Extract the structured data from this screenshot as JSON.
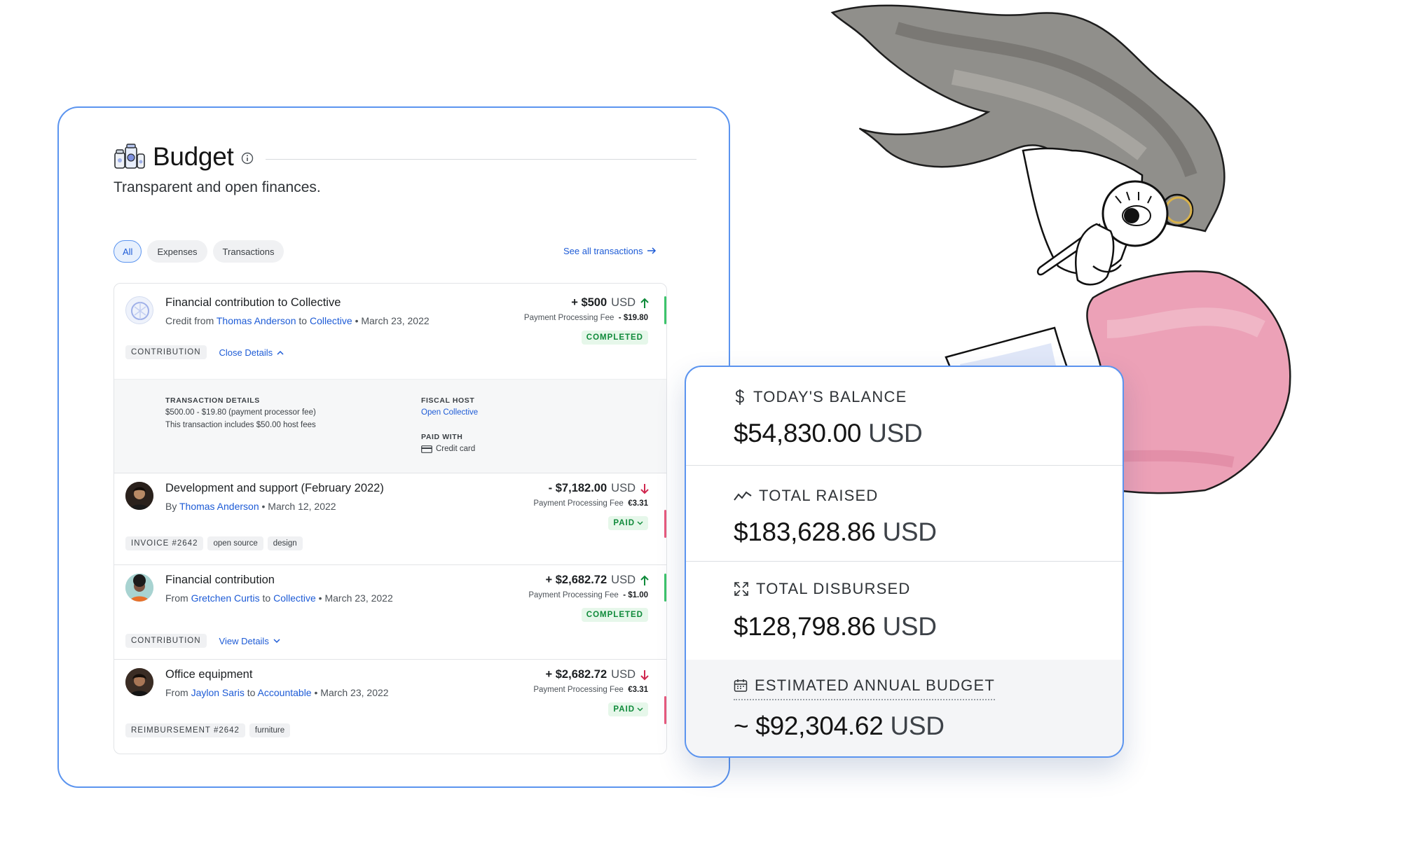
{
  "budget": {
    "title": "Budget",
    "subtitle": "Transparent and open finances.",
    "tabs": [
      {
        "label": "All",
        "active": true
      },
      {
        "label": "Expenses",
        "active": false
      },
      {
        "label": "Transactions",
        "active": false
      }
    ],
    "see_all": "See all transactions",
    "transactions": [
      {
        "title": "Financial contribution to Collective",
        "meta_prefix": "Credit from",
        "from": "Thomas Anderson",
        "connector": "to",
        "to": "Collective",
        "date": "• March 23, 2022",
        "amount_sign": "+ $500",
        "currency": "USD",
        "direction": "up",
        "fee_label": "Payment Processing Fee",
        "fee_value": "- $19.80",
        "status": "COMPLETED",
        "tags": [
          "CONTRIBUTION"
        ],
        "details_toggle": "Close Details",
        "details": {
          "tx_label": "TRANSACTION DETAILS",
          "tx_line1": "$500.00 - $19.80 (payment processor fee)",
          "tx_line2": "This transaction includes $50.00 host fees",
          "host_label": "FISCAL HOST",
          "host_value": "Open Collective",
          "paid_label": "PAID WITH",
          "paid_value": "Credit card"
        }
      },
      {
        "title": "Development and support (February 2022)",
        "meta_prefix": "By",
        "from": "Thomas Anderson",
        "date": "• March 12, 2022",
        "amount_sign": "- $7,182.00",
        "currency": "USD",
        "direction": "down",
        "fee_label": "Payment Processing Fee",
        "fee_value": "€3.31",
        "status": "PAID",
        "tags": [
          "INVOICE #2642",
          "open source",
          "design"
        ]
      },
      {
        "title": "Financial contribution",
        "meta_prefix": "From",
        "from": "Gretchen Curtis",
        "connector": "to",
        "to": "Collective",
        "date": "• March 23, 2022",
        "amount_sign": "+ $2,682.72",
        "currency": "USD",
        "direction": "up",
        "fee_label": "Payment Processing Fee",
        "fee_value": "- $1.00",
        "status": "COMPLETED",
        "tags": [
          "CONTRIBUTION"
        ],
        "details_toggle": "View Details"
      },
      {
        "title": "Office equipment",
        "meta_prefix": "From",
        "from": "Jaylon Saris",
        "connector": "to",
        "to": "Accountable",
        "date": "• March 23, 2022",
        "amount_sign": "+ $2,682.72",
        "currency": "USD",
        "direction": "down",
        "fee_label": "Payment Processing Fee",
        "fee_value": "€3.31",
        "status": "PAID",
        "tags": [
          "REIMBURSEMENT #2642",
          "furniture"
        ]
      }
    ]
  },
  "stats": [
    {
      "icon": "dollar-icon",
      "label": "TODAY'S BALANCE",
      "value": "$54,830.00",
      "currency": "USD"
    },
    {
      "icon": "trend-line-icon",
      "label": "TOTAL RAISED",
      "value": "$183,628.86",
      "currency": "USD"
    },
    {
      "icon": "expand-arrows-icon",
      "label": "TOTAL DISBURSED",
      "value": "$128,798.86",
      "currency": "USD"
    },
    {
      "icon": "calendar-icon",
      "label": "ESTIMATED ANNUAL BUDGET",
      "value": "~ $92,304.62",
      "currency": "USD"
    }
  ],
  "colors": {
    "accent": "#5b94ef",
    "link": "#1d5bd6",
    "positive": "#0f8a3a",
    "negative": "#d0284f",
    "status_bg": "#e6f7ea"
  }
}
